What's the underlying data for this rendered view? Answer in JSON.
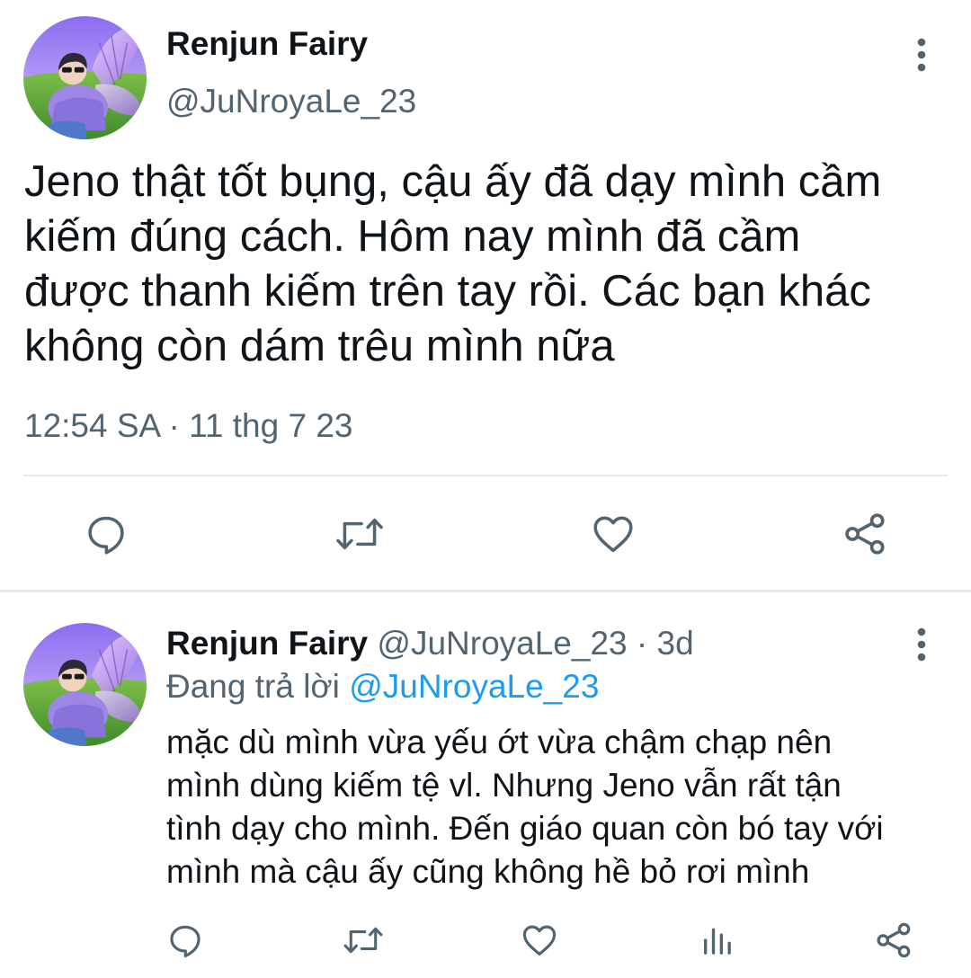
{
  "main_tweet": {
    "author": {
      "display_name": "Renjun Fairy",
      "handle": "@JuNroyaLe_23",
      "avatar_icon": "profile-photo"
    },
    "text_lines": [
      "Jeno thật tốt bụng, cậu ấy đã dạy mình cầm",
      "kiếm đúng cách. Hôm nay mình đã cầm",
      "được thanh kiếm trên tay rồi. Các bạn khác",
      "không còn dám trêu mình nữa"
    ],
    "timestamp": "12:54 SA · 11 thg 7 23",
    "actions": [
      "reply-icon",
      "retweet-icon",
      "like-icon",
      "share-icon"
    ],
    "more_icon": "more-vertical-icon"
  },
  "reply_tweet": {
    "author": {
      "display_name": "Renjun Fairy",
      "handle_meta": " @JuNroyaLe_23 · 3d",
      "avatar_icon": "profile-photo"
    },
    "replying_prefix": "Đang trả lời ",
    "replying_to": "@JuNroyaLe_23",
    "text_lines": [
      "mặc dù mình vừa yếu ớt vừa chậm chạp nên",
      "mình dùng kiếm tệ vl. Nhưng Jeno vẫn rất tận",
      "tình dạy cho mình. Đến giáo quan còn bó tay với",
      "mình mà cậu ấy cũng không hề bỏ rơi mình"
    ],
    "actions": [
      "reply-icon",
      "retweet-icon",
      "like-icon",
      "analytics-icon",
      "share-icon"
    ],
    "more_icon": "more-vertical-icon"
  },
  "colors": {
    "text_primary": "#0f1419",
    "text_secondary": "#536471",
    "accent": "#1d9bf0",
    "divider": "#e6e9eb"
  }
}
